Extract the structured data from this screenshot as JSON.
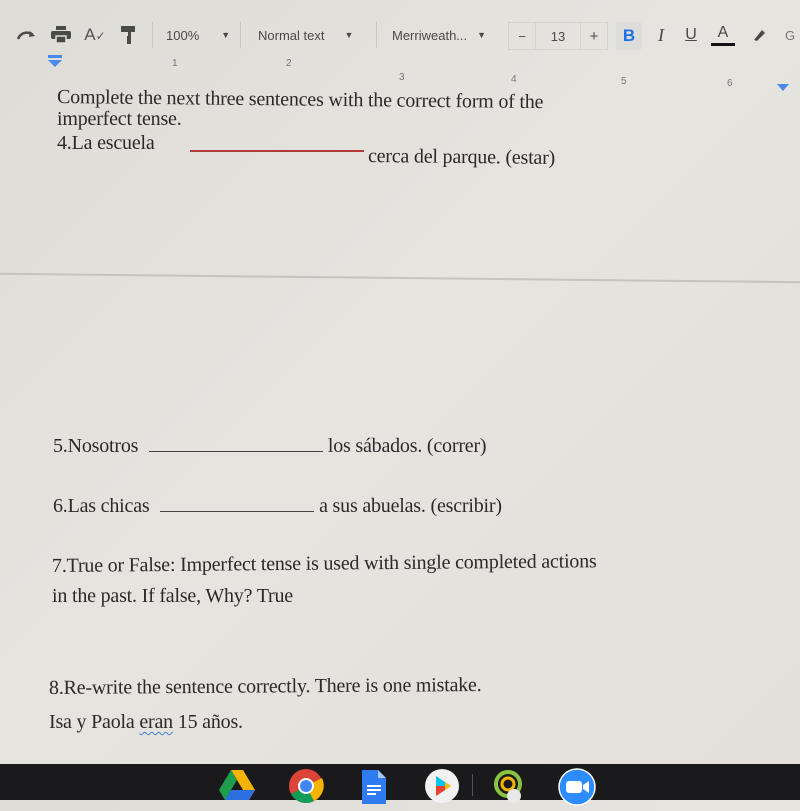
{
  "toolbar": {
    "zoom": "100%",
    "style": "Normal text",
    "font": "Merriweath...",
    "font_size": "13",
    "minus": "−",
    "plus": "+",
    "bold": "B",
    "italic": "I",
    "underline": "U",
    "text_color": "A",
    "more": "G"
  },
  "ruler": {
    "marks": [
      "1",
      "2",
      "3",
      "4",
      "5",
      "6"
    ]
  },
  "document": {
    "instructions_line1": "Complete the next three sentences with the correct form of the",
    "instructions_line2": "imperfect tense.",
    "q4": {
      "before": "4.La escuela",
      "after": "cerca del parque. (estar)"
    },
    "q5": {
      "before": "5.Nosotros",
      "after": "los sábados. (correr)"
    },
    "q6": {
      "before": "6.Las chicas",
      "after": "a sus abuelas. (escribir)"
    },
    "q7_line1": "7.True or False:  Imperfect tense is used with single completed actions",
    "q7_line2": "in the past.  If false, Why? True",
    "q8_line1": "8.Re-write the sentence correctly.  There is one mistake.",
    "q8_line2_pre": "Isa y Paola ",
    "q8_line2_flag": "eran",
    "q8_line2_post": " 15 años."
  },
  "taskbar": {
    "apps": [
      "google-drive",
      "chrome",
      "google-docs",
      "play-store",
      "clock-app",
      "zoom"
    ]
  },
  "colors": {
    "accent": "#1a73e8",
    "bold_active": "#1a73e8",
    "spell_underline": "#b33b3b"
  }
}
